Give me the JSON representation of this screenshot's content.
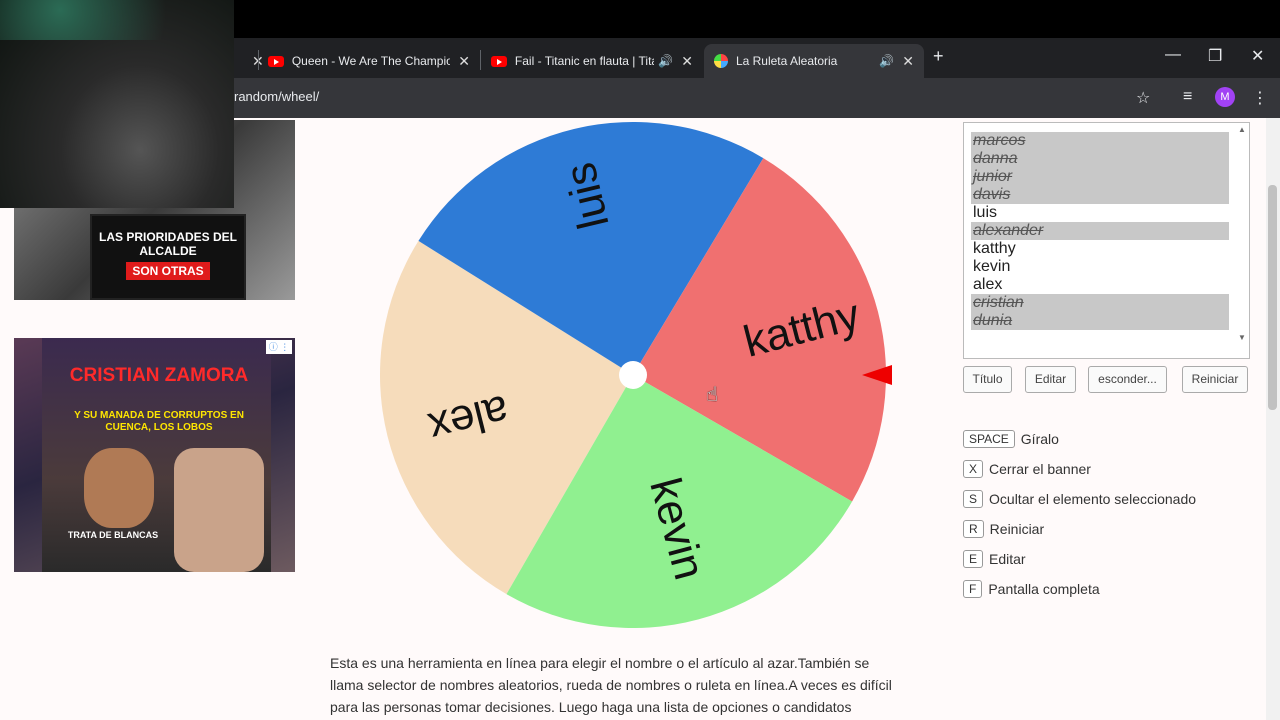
{
  "browser": {
    "tabs": [
      {
        "title": "Queen - We Are The Champion",
        "icon": "youtube-icon"
      },
      {
        "title": "Fail - Titanic en flauta | Titan",
        "icon": "youtube-icon"
      },
      {
        "title": "La Ruleta Aleatoria",
        "icon": "wheel-favicon-icon"
      }
    ],
    "url": "random/wheel/",
    "profile_initial": "M"
  },
  "ads": {
    "ad1_line1": "LAS PRIORIDADES DEL ALCALDE",
    "ad1_line2": "SON OTRAS",
    "ad2_headline": "CRISTIAN ZAMORA",
    "ad2_sub": "Y SU MANADA DE CORRUPTOS EN CUENCA, LOS LOBOS",
    "ad2_bottom": "TRATA DE BLANCAS"
  },
  "wheel": {
    "segments": [
      {
        "label": "alex",
        "color": "#f6dcbb"
      },
      {
        "label": "luis",
        "color": "#2e7bd6"
      },
      {
        "label": "katthy",
        "color": "#f07070"
      },
      {
        "label": "kevin",
        "color": "#90f090"
      }
    ],
    "pointer_color": "#e00000"
  },
  "names_list": [
    {
      "name": "marcos",
      "hidden": true
    },
    {
      "name": "danna",
      "hidden": true
    },
    {
      "name": "junior",
      "hidden": true
    },
    {
      "name": "davis",
      "hidden": true
    },
    {
      "name": "luis",
      "hidden": false
    },
    {
      "name": "alexander",
      "hidden": true
    },
    {
      "name": "katthy",
      "hidden": false
    },
    {
      "name": "kevin",
      "hidden": false
    },
    {
      "name": "alex",
      "hidden": false
    },
    {
      "name": "cristian",
      "hidden": true
    },
    {
      "name": "dunia",
      "hidden": true
    }
  ],
  "buttons": {
    "title": "Título",
    "edit": "Editar",
    "hide": "esconder...",
    "reset": "Reiniciar"
  },
  "shortcuts": [
    {
      "key": "SPACE",
      "label": "Gíralo"
    },
    {
      "key": "X",
      "label": "Cerrar el banner"
    },
    {
      "key": "S",
      "label": "Ocultar el elemento seleccionado"
    },
    {
      "key": "R",
      "label": "Reiniciar"
    },
    {
      "key": "E",
      "label": "Editar"
    },
    {
      "key": "F",
      "label": "Pantalla completa"
    }
  ],
  "description": {
    "line1": "Esta es una herramienta en línea para elegir el nombre o el artículo al azar.También se",
    "line2": "llama selector de nombres aleatorios, rueda de nombres o ruleta en línea.A veces es difícil",
    "line3": "para las personas tomar decisiones. Luego haga una lista de opciones o candidatos"
  }
}
